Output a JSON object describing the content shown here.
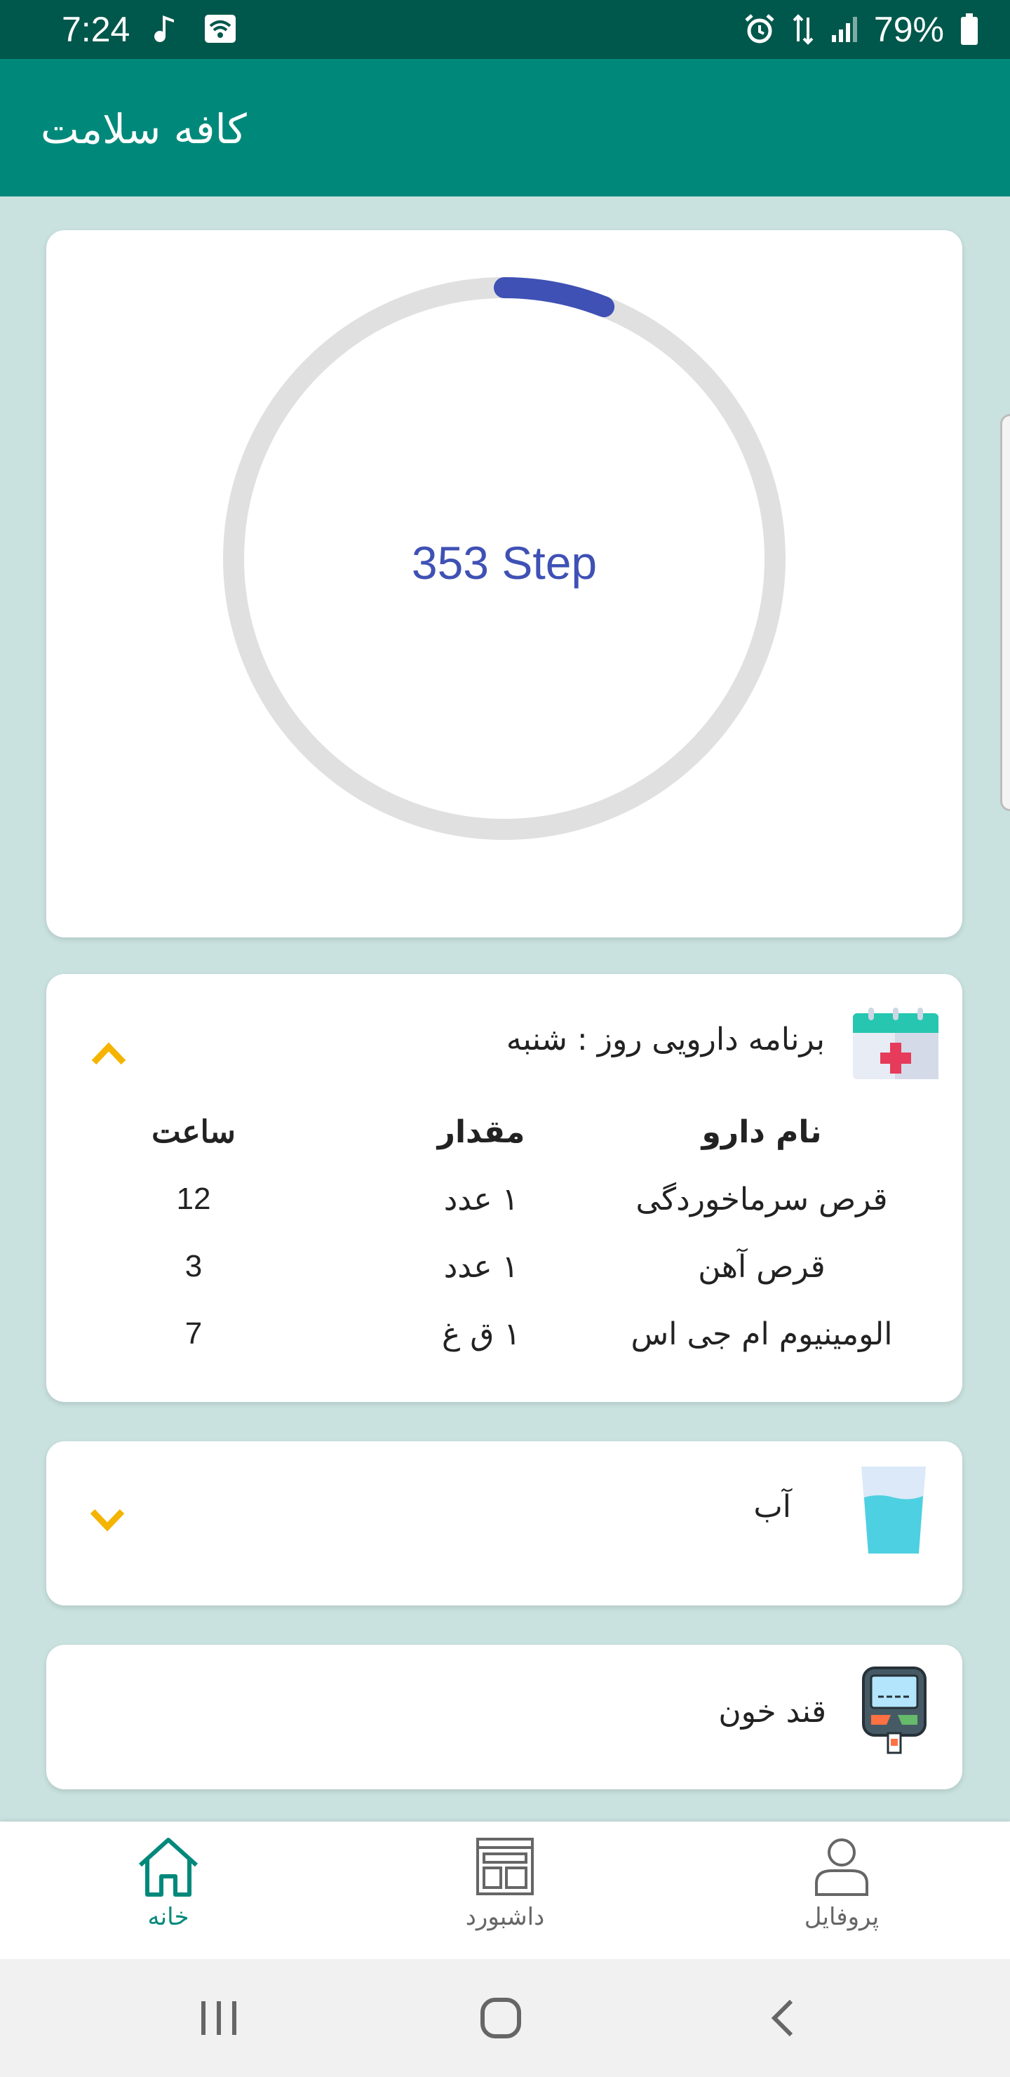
{
  "status_bar": {
    "time": "7:24",
    "battery": "79%"
  },
  "app_bar": {
    "title": "کافه سلامت"
  },
  "steps": {
    "text": "353 Step",
    "progress_fraction": 0.06,
    "ring_color": "#3f51b5",
    "track_color": "#e0e0e0"
  },
  "medication": {
    "title": "برنامه دارویی روز :",
    "day": "شنبه",
    "headers": {
      "name": "نام دارو",
      "quantity": "مقدار",
      "time": "ساعت"
    },
    "rows": [
      {
        "name": "قرص سرماخوردگی",
        "quantity": "۱ عدد",
        "time": "12"
      },
      {
        "name": "قرص آهن",
        "quantity": "۱ عدد",
        "time": "3"
      },
      {
        "name": "الومینیوم ام جی اس",
        "quantity": "۱ ق غ",
        "time": "7"
      }
    ],
    "icon": "calendar-medical-icon"
  },
  "water": {
    "title": "آب",
    "icon": "water-glass-icon"
  },
  "blood_sugar": {
    "title": "قند خون",
    "icon": "glucometer-icon"
  },
  "bottom_nav": {
    "items": [
      {
        "label": "خانه",
        "icon": "home-icon",
        "active": true
      },
      {
        "label": "داشبورد",
        "icon": "dashboard-icon",
        "active": false
      },
      {
        "label": "پروفایل",
        "icon": "profile-icon",
        "active": false
      }
    ]
  },
  "colors": {
    "primary": "#00897b",
    "primary_dark": "#00574b",
    "accent": "#f5b400",
    "background": "#c9e2df"
  }
}
